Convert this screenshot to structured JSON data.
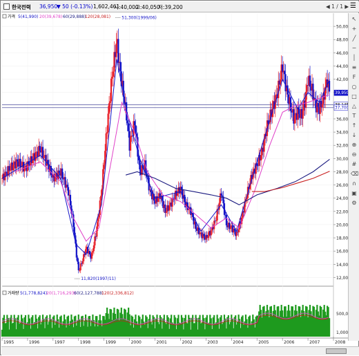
{
  "toolbar": {
    "stock_name": "한국전력",
    "price": "36,950",
    "change": "▼ 50 (-0.13%)",
    "volume": "1,602,461",
    "open": "시:40,000",
    "high": "고:40,050",
    "low": "저:39,200",
    "nav": "◀ 1 / 1 ▶",
    "menu_icon": "list-icon"
  },
  "price_legend": {
    "prefix": "가격",
    "ma5": "5(41,990)",
    "ma20": "20(39,678)",
    "ma60": "60(29,888)",
    "ma120": "120(28,081)"
  },
  "volume_legend": {
    "prefix": "거래량",
    "ma5": "5(1,778,824)",
    "ma20": "20(1,716,293)",
    "ma60": "60(2,127,788)",
    "ma120": "120(2,336,812)"
  },
  "colors": {
    "up": "#e8202a",
    "down": "#1414c8",
    "ma_short": "#1414c8",
    "ma_mid": "#e040c8",
    "ma_long": "#1a1a80",
    "ma_longest": "#c81e1e",
    "volume_bar": "#1e9a1e",
    "hline": "#5050a0"
  },
  "chart_data": {
    "type": "candlestick",
    "title": "",
    "x_ticks": [
      "1995",
      "1996",
      "1997",
      "1998",
      "1999",
      "2000",
      "2001",
      "2002",
      "2003",
      "2004",
      "2005",
      "2006",
      "2007",
      "2008"
    ],
    "y_ticks": [
      "50,000",
      "48,000",
      "46,000",
      "44,000",
      "42,000",
      "40,000",
      "38,000",
      "36,000",
      "34,000",
      "32,000",
      "30,000",
      "28,000",
      "26,000",
      "24,000",
      "22,000",
      "20,000",
      "18,000",
      "16,000",
      "14,000",
      "12,000"
    ],
    "ylim": [
      11000,
      52000
    ],
    "price_tags": [
      "39,950",
      "38,145",
      "37,700"
    ],
    "annotations": [
      {
        "text": "51,300(1999/06)",
        "x": 1999.45,
        "y": 51300
      },
      {
        "text": "11,820(1997/11)",
        "x": 1997.85,
        "y": 11820
      }
    ],
    "volume_ticks": [
      "500,000",
      "1,000"
    ],
    "close_path": [
      [
        1995.0,
        27000
      ],
      [
        1995.3,
        28500
      ],
      [
        1995.6,
        29500
      ],
      [
        1995.9,
        28500
      ],
      [
        1996.2,
        30000
      ],
      [
        1996.5,
        31500
      ],
      [
        1996.8,
        29000
      ],
      [
        1997.0,
        27000
      ],
      [
        1997.3,
        28000
      ],
      [
        1997.6,
        25000
      ],
      [
        1997.8,
        20000
      ],
      [
        1997.9,
        16000
      ],
      [
        1998.0,
        13000
      ],
      [
        1998.15,
        14500
      ],
      [
        1998.3,
        16500
      ],
      [
        1998.5,
        15000
      ],
      [
        1998.7,
        19000
      ],
      [
        1998.9,
        25000
      ],
      [
        1999.1,
        34000
      ],
      [
        1999.3,
        42000
      ],
      [
        1999.5,
        48000
      ],
      [
        1999.6,
        44000
      ],
      [
        1999.75,
        40000
      ],
      [
        1999.9,
        36000
      ],
      [
        2000.0,
        32000
      ],
      [
        2000.2,
        35500
      ],
      [
        2000.4,
        28000
      ],
      [
        2000.6,
        29000
      ],
      [
        2000.8,
        25000
      ],
      [
        2001.0,
        23500
      ],
      [
        2001.2,
        24500
      ],
      [
        2001.4,
        22000
      ],
      [
        2001.6,
        23000
      ],
      [
        2001.8,
        24500
      ],
      [
        2002.0,
        25500
      ],
      [
        2002.2,
        23000
      ],
      [
        2002.4,
        22000
      ],
      [
        2002.6,
        19500
      ],
      [
        2002.8,
        18500
      ],
      [
        2003.0,
        18000
      ],
      [
        2003.2,
        19000
      ],
      [
        2003.4,
        21000
      ],
      [
        2003.6,
        25000
      ],
      [
        2003.8,
        20000
      ],
      [
        2004.0,
        19500
      ],
      [
        2004.2,
        18500
      ],
      [
        2004.4,
        21000
      ],
      [
        2004.6,
        24500
      ],
      [
        2004.8,
        27500
      ],
      [
        2005.0,
        29000
      ],
      [
        2005.2,
        31000
      ],
      [
        2005.4,
        35000
      ],
      [
        2005.6,
        37500
      ],
      [
        2005.8,
        40000
      ],
      [
        2006.0,
        44000
      ],
      [
        2006.15,
        40500
      ],
      [
        2006.3,
        38000
      ],
      [
        2006.45,
        36000
      ],
      [
        2006.6,
        37000
      ],
      [
        2006.75,
        36500
      ],
      [
        2006.9,
        39000
      ],
      [
        2007.0,
        42000
      ],
      [
        2007.15,
        40500
      ],
      [
        2007.3,
        38000
      ],
      [
        2007.45,
        37500
      ],
      [
        2007.6,
        39000
      ],
      [
        2007.75,
        42000
      ],
      [
        2007.85,
        39950
      ]
    ],
    "ma5": [
      [
        1995.0,
        27000
      ],
      [
        1996.5,
        30500
      ],
      [
        1997.3,
        27000
      ],
      [
        1997.9,
        17000
      ],
      [
        1998.3,
        15500
      ],
      [
        1998.9,
        23000
      ],
      [
        1999.5,
        45000
      ],
      [
        1999.9,
        37000
      ],
      [
        2000.4,
        30000
      ],
      [
        2001.0,
        24000
      ],
      [
        2002.0,
        25000
      ],
      [
        2002.8,
        19000
      ],
      [
        2003.6,
        23000
      ],
      [
        2004.2,
        19000
      ],
      [
        2004.8,
        27000
      ],
      [
        2005.6,
        37000
      ],
      [
        2006.0,
        42000
      ],
      [
        2006.6,
        37500
      ],
      [
        2007.0,
        40000
      ],
      [
        2007.45,
        38500
      ],
      [
        2007.85,
        41990
      ]
    ],
    "ma20": [
      [
        1995.5,
        28000
      ],
      [
        1996.5,
        29500
      ],
      [
        1997.3,
        26500
      ],
      [
        1997.8,
        21000
      ],
      [
        1998.3,
        17500
      ],
      [
        1998.8,
        19500
      ],
      [
        1999.3,
        30000
      ],
      [
        1999.7,
        38500
      ],
      [
        2000.2,
        34000
      ],
      [
        2000.7,
        28000
      ],
      [
        2001.3,
        24500
      ],
      [
        2002.0,
        23500
      ],
      [
        2002.6,
        21500
      ],
      [
        2003.2,
        19500
      ],
      [
        2003.8,
        21000
      ],
      [
        2004.3,
        19500
      ],
      [
        2004.9,
        25000
      ],
      [
        2005.5,
        32000
      ],
      [
        2006.0,
        37000
      ],
      [
        2006.5,
        38000
      ],
      [
        2007.0,
        38500
      ],
      [
        2007.85,
        39678
      ]
    ],
    "ma60": [
      [
        1999.85,
        27500
      ],
      [
        2000.3,
        28000
      ],
      [
        2001.0,
        27000
      ],
      [
        2001.8,
        25500
      ],
      [
        2002.5,
        25000
      ],
      [
        2003.2,
        24500
      ],
      [
        2003.8,
        24000
      ],
      [
        2004.3,
        23000
      ],
      [
        2005.0,
        24500
      ],
      [
        2005.8,
        25500
      ],
      [
        2006.5,
        26500
      ],
      [
        2007.2,
        28000
      ],
      [
        2007.85,
        29888
      ]
    ],
    "ma120": [
      [
        2004.8,
        25000
      ],
      [
        2005.3,
        25000
      ],
      [
        2006.0,
        25600
      ],
      [
        2006.6,
        26300
      ],
      [
        2007.2,
        27000
      ],
      [
        2007.85,
        28081
      ]
    ]
  }
}
